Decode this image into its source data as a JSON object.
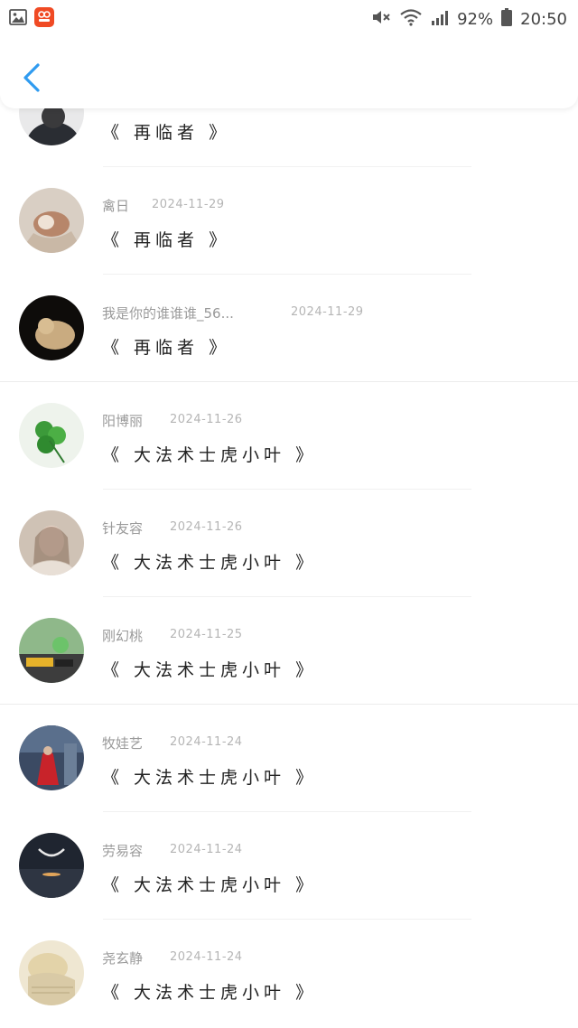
{
  "status_bar": {
    "battery": "92%",
    "time": "20:50",
    "icons": [
      "gallery-icon",
      "app-icon",
      "mute-icon",
      "wifi-icon",
      "signal-icon",
      "battery-icon"
    ]
  },
  "header": {
    "back_icon": "chevron-left-icon",
    "accent": "#2f9bf0"
  },
  "messages": [
    {
      "name": "",
      "date": "",
      "text": "《 再临者 》"
    },
    {
      "name": "禽日",
      "date": "2024-11-29",
      "text": "《 再临者 》"
    },
    {
      "name": "我是你的谁谁谁_56...",
      "date": "2024-11-29",
      "text": "《 再临者 》"
    },
    {
      "name": "阳博丽",
      "date": "2024-11-26",
      "text": "《 大法术士虎小叶 》"
    },
    {
      "name": "针友容",
      "date": "2024-11-26",
      "text": "《 大法术士虎小叶 》"
    },
    {
      "name": "刚幻桃",
      "date": "2024-11-25",
      "text": "《 大法术士虎小叶 》"
    },
    {
      "name": "牧娃艺",
      "date": "2024-11-24",
      "text": "《 大法术士虎小叶 》"
    },
    {
      "name": "劳易容",
      "date": "2024-11-24",
      "text": "《 大法术士虎小叶 》"
    },
    {
      "name": "尧玄静",
      "date": "2024-11-24",
      "text": "《 大法术士虎小叶 》"
    }
  ]
}
